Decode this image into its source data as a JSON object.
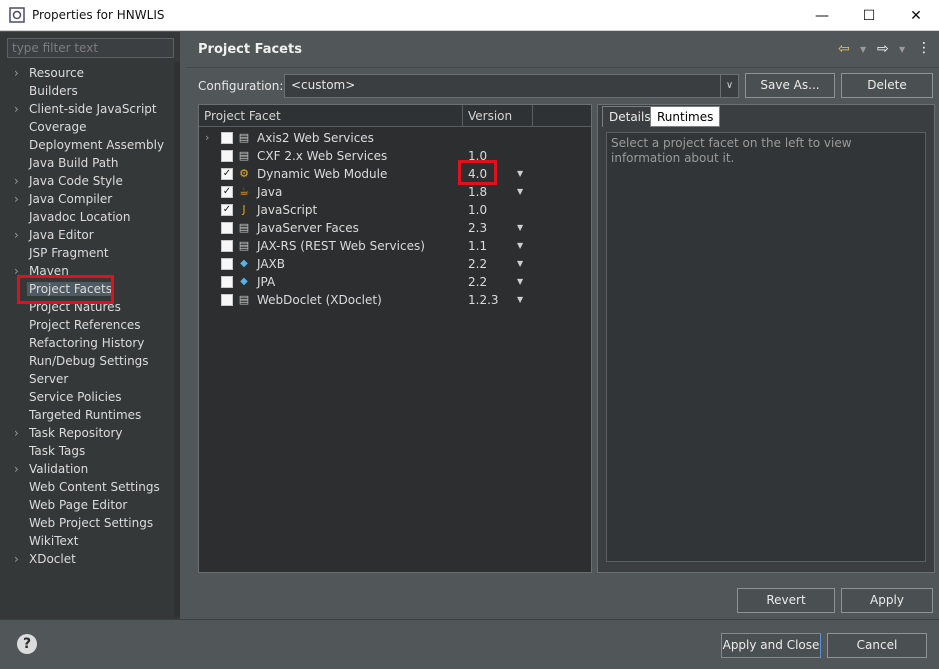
{
  "window": {
    "title": "Properties for HNWLIS",
    "minimize": "—",
    "maximize": "☐",
    "close": "✕"
  },
  "left_nav": {
    "filter_placeholder": "type filter text",
    "items": [
      {
        "label": "Resource",
        "expandable": true
      },
      {
        "label": "Builders",
        "expandable": false
      },
      {
        "label": "Client-side JavaScript",
        "expandable": true
      },
      {
        "label": "Coverage",
        "expandable": false
      },
      {
        "label": "Deployment Assembly",
        "expandable": false
      },
      {
        "label": "Java Build Path",
        "expandable": false
      },
      {
        "label": "Java Code Style",
        "expandable": true
      },
      {
        "label": "Java Compiler",
        "expandable": true
      },
      {
        "label": "Javadoc Location",
        "expandable": false
      },
      {
        "label": "Java Editor",
        "expandable": true
      },
      {
        "label": "JSP Fragment",
        "expandable": false
      },
      {
        "label": "Maven",
        "expandable": true
      },
      {
        "label": "Project Facets",
        "expandable": false,
        "selected": true
      },
      {
        "label": "Project Natures",
        "expandable": false
      },
      {
        "label": "Project References",
        "expandable": false
      },
      {
        "label": "Refactoring History",
        "expandable": false
      },
      {
        "label": "Run/Debug Settings",
        "expandable": false
      },
      {
        "label": "Server",
        "expandable": false
      },
      {
        "label": "Service Policies",
        "expandable": false
      },
      {
        "label": "Targeted Runtimes",
        "expandable": false
      },
      {
        "label": "Task Repository",
        "expandable": true
      },
      {
        "label": "Task Tags",
        "expandable": false
      },
      {
        "label": "Validation",
        "expandable": true
      },
      {
        "label": "Web Content Settings",
        "expandable": false
      },
      {
        "label": "Web Page Editor",
        "expandable": false
      },
      {
        "label": "Web Project Settings",
        "expandable": false
      },
      {
        "label": "WikiText",
        "expandable": false
      },
      {
        "label": "XDoclet",
        "expandable": true
      }
    ]
  },
  "main": {
    "title": "Project Facets",
    "config_label": "Configuration:",
    "config_value": "<custom>",
    "save_as": "Save As...",
    "delete": "Delete",
    "table": {
      "col_facet": "Project Facet",
      "col_version": "Version",
      "rows": [
        {
          "name": "Axis2 Web Services",
          "version": "",
          "checked": false,
          "expandable": true,
          "icon": "document-icon",
          "dropdown": false
        },
        {
          "name": "CXF 2.x Web Services",
          "version": "1.0",
          "checked": false,
          "expandable": false,
          "icon": "document-icon",
          "dropdown": false
        },
        {
          "name": "Dynamic Web Module",
          "version": "4.0",
          "checked": true,
          "expandable": false,
          "icon": "web-module-icon",
          "dropdown": true
        },
        {
          "name": "Java",
          "version": "1.8",
          "checked": true,
          "expandable": false,
          "icon": "java-icon",
          "dropdown": true
        },
        {
          "name": "JavaScript",
          "version": "1.0",
          "checked": true,
          "expandable": false,
          "icon": "javascript-icon",
          "dropdown": false
        },
        {
          "name": "JavaServer Faces",
          "version": "2.3",
          "checked": false,
          "expandable": false,
          "icon": "document-icon",
          "dropdown": true
        },
        {
          "name": "JAX-RS (REST Web Services)",
          "version": "1.1",
          "checked": false,
          "expandable": false,
          "icon": "document-icon",
          "dropdown": true
        },
        {
          "name": "JAXB",
          "version": "2.2",
          "checked": false,
          "expandable": false,
          "icon": "diamond-icon",
          "dropdown": true
        },
        {
          "name": "JPA",
          "version": "2.2",
          "checked": false,
          "expandable": false,
          "icon": "diamond-icon",
          "dropdown": true
        },
        {
          "name": "WebDoclet (XDoclet)",
          "version": "1.2.3",
          "checked": false,
          "expandable": false,
          "icon": "document-icon",
          "dropdown": true
        }
      ]
    },
    "details": {
      "tab_details": "Details",
      "tab_runtimes": "Runtimes",
      "text": "Select a project facet on the left to view information about it."
    },
    "revert": "Revert",
    "apply": "Apply"
  },
  "footer": {
    "help": "?",
    "apply_close": "Apply and Close",
    "cancel": "Cancel"
  },
  "colors": {
    "highlight_red": "#e0101e",
    "background": "#515658",
    "nav_background": "#343839"
  }
}
